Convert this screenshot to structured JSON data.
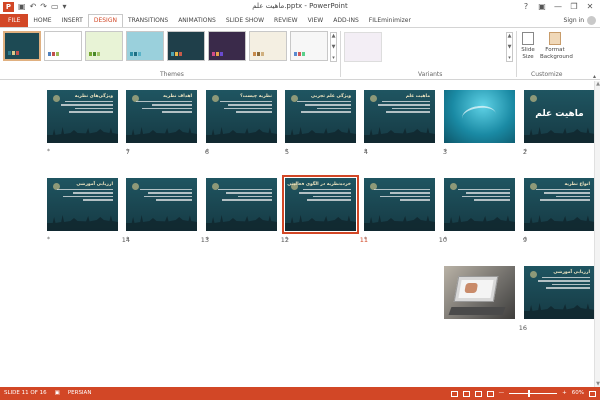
{
  "window": {
    "title": "ماهیت علم.pptx - PowerPoint",
    "app_logo": "P",
    "controls": [
      "?",
      "▣",
      "—",
      "❐",
      "✕"
    ]
  },
  "quick_access": [
    "save-icon",
    "undo-icon",
    "redo-icon",
    "start-icon",
    "customize-icon"
  ],
  "ribbon_tabs": [
    "FILE",
    "HOME",
    "INSERT",
    "DESIGN",
    "TRANSITIONS",
    "ANIMATIONS",
    "SLIDE SHOW",
    "REVIEW",
    "VIEW",
    "ADD-INS",
    "FILEminimizer"
  ],
  "active_tab": "DESIGN",
  "sign_in": "Sign in",
  "ribbon": {
    "themes_label": "Themes",
    "variants_label": "Variants",
    "customize_label": "Customize",
    "slide_size": "Slide Size",
    "format_background": "Format Background",
    "themes": [
      {
        "bg": "#1d4a54",
        "fg": "#f0e6c2",
        "bars": [
          "#2e7a8a",
          "#d9c98a",
          "#c0504d"
        ]
      },
      {
        "bg": "#ffffff",
        "fg": "#333333",
        "bars": [
          "#4f81bd",
          "#c0504d",
          "#9bbb59"
        ]
      },
      {
        "bg": "#e8f3d6",
        "fg": "#3a5a1a",
        "bars": [
          "#76a831",
          "#4a8a2a",
          "#a4c66a"
        ]
      },
      {
        "bg": "#9ad0dc",
        "fg": "#1e4f5a",
        "bars": [
          "#2b8fa7",
          "#1e6e82",
          "#5ab3c8"
        ]
      },
      {
        "bg": "#1f3f4a",
        "fg": "#e6e6e6",
        "bars": [
          "#4aa3b5",
          "#e6b84a",
          "#c75a4a"
        ]
      },
      {
        "bg": "#3a2a4a",
        "fg": "#f0d0e0",
        "bars": [
          "#d04a8a",
          "#e6a04a",
          "#6a4ad0"
        ]
      },
      {
        "bg": "#f4efe2",
        "fg": "#6a4a2a",
        "bars": [
          "#c88a4a",
          "#8a6a3a",
          "#d0b080"
        ]
      },
      {
        "bg": "#f7f7f7",
        "fg": "#444444",
        "bars": [
          "#5a8ad0",
          "#d05a5a",
          "#5ad08a"
        ]
      }
    ]
  },
  "slides": [
    {
      "n": "1",
      "kind": "title",
      "title": "ماهیت علم"
    },
    {
      "n": "2",
      "kind": "teal"
    },
    {
      "n": "3",
      "kind": "text",
      "heading": "ماهیت علم"
    },
    {
      "n": "4",
      "kind": "text",
      "heading": "ویژگی علم تجربی"
    },
    {
      "n": "5",
      "kind": "text",
      "heading": "نظریه چیست؟"
    },
    {
      "n": "6",
      "kind": "text",
      "heading": "اهداف نظریه"
    },
    {
      "n": "7",
      "kind": "text",
      "heading": "ویژگی‌های نظریه"
    },
    {
      "n": "8",
      "kind": "text",
      "heading": "انواع نظریه"
    },
    {
      "n": "9",
      "kind": "text",
      "heading": ""
    },
    {
      "n": "10",
      "kind": "text",
      "heading": ""
    },
    {
      "n": "11",
      "kind": "text",
      "heading": "خرده‌نظریه در الگوی فعالیتی"
    },
    {
      "n": "12",
      "kind": "text",
      "heading": ""
    },
    {
      "n": "13",
      "kind": "text",
      "heading": ""
    },
    {
      "n": "14",
      "kind": "text",
      "heading": "ارزیابی آموزشی"
    },
    {
      "n": "15",
      "kind": "text",
      "heading": "ارزیابی آموزشی"
    },
    {
      "n": "16",
      "kind": "photo"
    }
  ],
  "selected_slide": "11",
  "transition_marker": "*",
  "status": {
    "slide_info": "SLIDE 11 OF 16",
    "language": "PERSIAN",
    "zoom": "60%",
    "zoom_minus": "—",
    "zoom_plus": "+"
  }
}
